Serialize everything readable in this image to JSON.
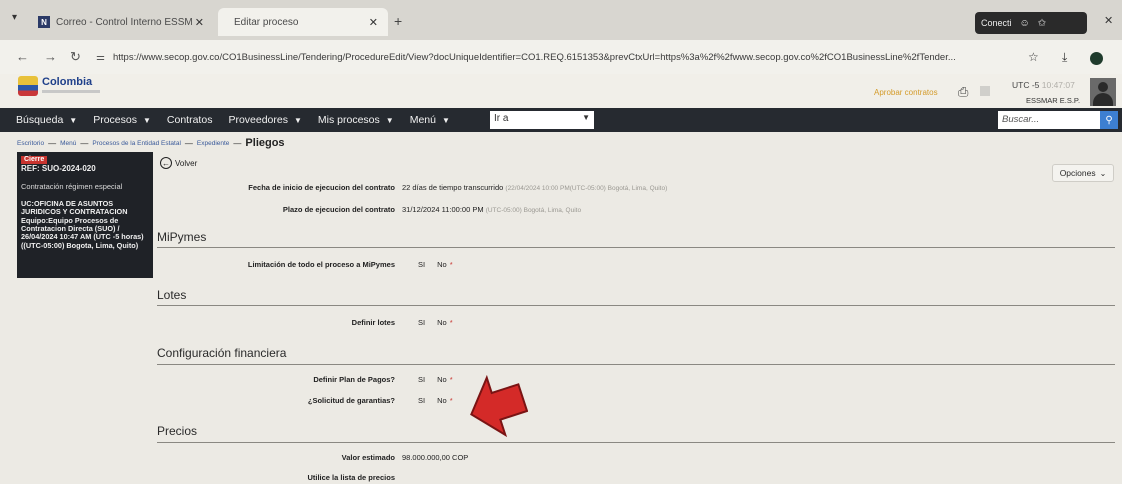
{
  "browser": {
    "tabs": [
      {
        "label": "Correo - Control Interno ESSM",
        "active": false
      },
      {
        "label": "Editar proceso",
        "active": true
      }
    ],
    "profile_label": "Conecti",
    "url": "https://www.secop.gov.co/CO1BusinessLine/Tendering/ProcedureEdit/View?docUniqueIdentifier=CO1.REQ.6151353&prevCtxUrl=https%3a%2f%2fwww.secop.gov.co%2fCO1BusinessLine%2fTender..."
  },
  "header": {
    "logo_text": "Colombia",
    "utc_label": "UTC -5",
    "utc_time": "10:47:07",
    "user": "ESSMAR E.S.P.",
    "link_faded": "Aprobar contratos"
  },
  "nav": {
    "items": [
      "Búsqueda",
      "Procesos",
      "Contratos",
      "Proveedores",
      "Mis procesos",
      "Menú"
    ],
    "goto_value": "Ir a",
    "search_placeholder": "Buscar..."
  },
  "breadcrumb": {
    "items": [
      "Escritorio",
      "Menú",
      "Procesos de la Entidad Estatal",
      "Expediente"
    ],
    "current": "Pliegos"
  },
  "panel": {
    "badge": "Cierre",
    "ref": "REF: SUO-2024-020",
    "modality": "Contratación régimen especial",
    "unit": "UC:OFICINA DE ASUNTOS JURIDICOS Y CONTRATACION Equipo:Equipo Procesos de Contratacion Directa (SUO) / 26/04/2024 10:47 AM (UTC -5 horas)((UTC-05:00) Bogota, Lima, Quito)"
  },
  "buttons": {
    "volver": "Volver",
    "opciones": "Opciones"
  },
  "fields": {
    "fecha_inicio_label": "Fecha de inicio de ejecucion del contrato",
    "fecha_inicio_value": "22 días de tiempo transcurrido",
    "fecha_inicio_tz": "(22/04/2024 10:00 PM(UTC-05:00) Bogotá, Lima, Quito)",
    "plazo_label": "Plazo de ejecucion del contrato",
    "plazo_value": "31/12/2024 11:00:00 PM",
    "plazo_tz": "(UTC-05:00) Bogotá, Lima, Quito",
    "limitacion_label": "Limitación de todo el proceso a MiPymes",
    "definir_lotes_label": "Definir lotes",
    "definir_plan_label": "Definir Plan de Pagos?",
    "solicitud_garantias_label": "¿Solicitud de garantias?",
    "valor_label": "Valor estimado",
    "valor_value": "98.000.000,00 COP",
    "lista_precios_label": "Utilice la lista de precios",
    "si": "SI",
    "no": "No",
    "req": "*"
  },
  "sections": {
    "mipymes": "MiPymes",
    "lotes": "Lotes",
    "financiera": "Configuración financiera",
    "precios": "Precios"
  },
  "colors": {
    "nav_bg": "#262a30",
    "panel_bg": "#1f2227",
    "badge": "#c8342f",
    "arrow": "#d42a28",
    "search_btn": "#3d7fd1"
  }
}
